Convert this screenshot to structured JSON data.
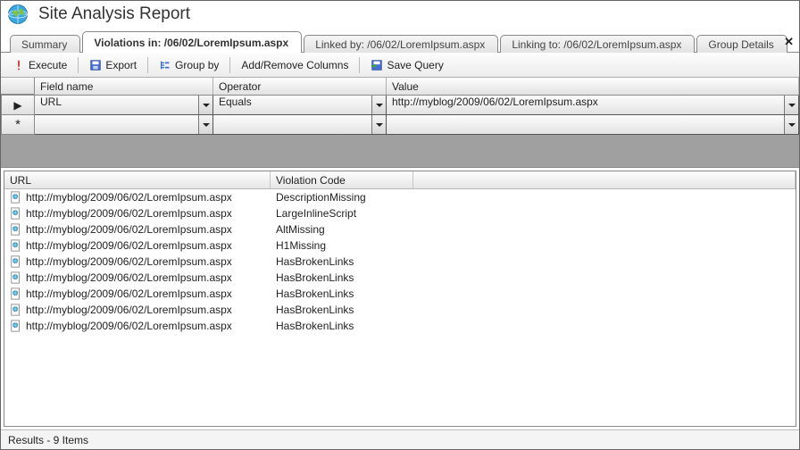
{
  "title": "Site Analysis Report",
  "tabs": [
    {
      "label": "Summary",
      "active": false
    },
    {
      "label": "Violations in: /06/02/LoremIpsum.aspx",
      "active": true
    },
    {
      "label": "Linked by: /06/02/LoremIpsum.aspx",
      "active": false
    },
    {
      "label": "Linking to: /06/02/LoremIpsum.aspx",
      "active": false
    },
    {
      "label": "Group Details",
      "active": false
    }
  ],
  "toolbar": {
    "execute": "Execute",
    "export": "Export",
    "groupby": "Group by",
    "addremove": "Add/Remove Columns",
    "savequery": "Save Query"
  },
  "query": {
    "headers": {
      "field": "Field name",
      "operator": "Operator",
      "value": "Value"
    },
    "rows": [
      {
        "marker": "▶",
        "field": "URL",
        "operator": "Equals",
        "value": "http://myblog/2009/06/02/LoremIpsum.aspx"
      },
      {
        "marker": "*",
        "field": "",
        "operator": "",
        "value": ""
      }
    ]
  },
  "results": {
    "headers": {
      "url": "URL",
      "code": "Violation Code"
    },
    "rows": [
      {
        "url": "http://myblog/2009/06/02/LoremIpsum.aspx",
        "code": "DescriptionMissing"
      },
      {
        "url": "http://myblog/2009/06/02/LoremIpsum.aspx",
        "code": "LargeInlineScript"
      },
      {
        "url": "http://myblog/2009/06/02/LoremIpsum.aspx",
        "code": "AltMissing"
      },
      {
        "url": "http://myblog/2009/06/02/LoremIpsum.aspx",
        "code": "H1Missing"
      },
      {
        "url": "http://myblog/2009/06/02/LoremIpsum.aspx",
        "code": "HasBrokenLinks"
      },
      {
        "url": "http://myblog/2009/06/02/LoremIpsum.aspx",
        "code": "HasBrokenLinks"
      },
      {
        "url": "http://myblog/2009/06/02/LoremIpsum.aspx",
        "code": "HasBrokenLinks"
      },
      {
        "url": "http://myblog/2009/06/02/LoremIpsum.aspx",
        "code": "HasBrokenLinks"
      },
      {
        "url": "http://myblog/2009/06/02/LoremIpsum.aspx",
        "code": "HasBrokenLinks"
      }
    ]
  },
  "status": "Results - 9 Items"
}
